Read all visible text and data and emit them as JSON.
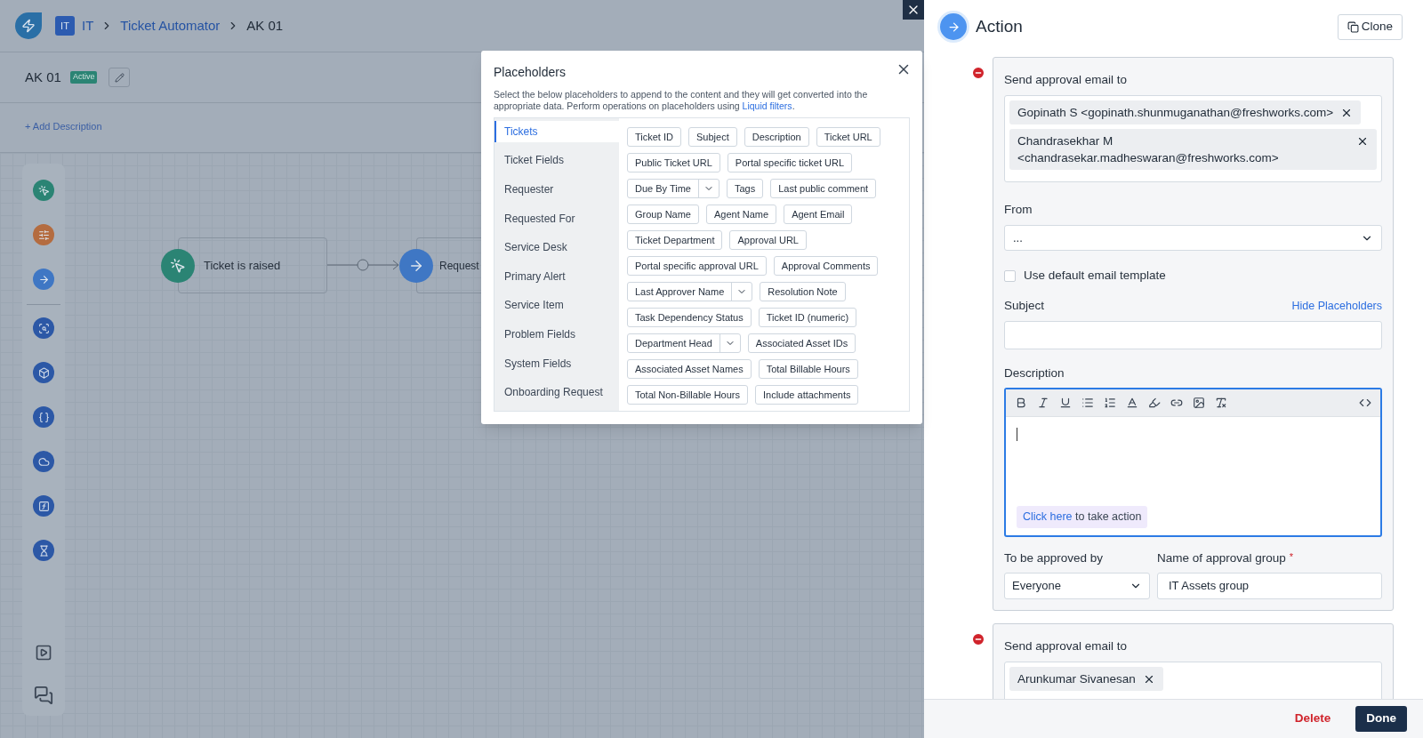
{
  "header": {
    "workspace_badge": "IT",
    "breadcrumb": [
      {
        "label": "IT",
        "kind": "link"
      },
      {
        "label": "Ticket Automator",
        "kind": "link"
      },
      {
        "label": "AK 01",
        "kind": "current"
      }
    ]
  },
  "workflow": {
    "name": "AK 01",
    "status": "Active",
    "add_description": "+ Add Description"
  },
  "canvas": {
    "nodes": [
      {
        "kind": "trigger",
        "label": "Ticket is raised"
      },
      {
        "kind": "action",
        "label": "Request"
      }
    ]
  },
  "placeholders_modal": {
    "title": "Placeholders",
    "description": "Select the below placeholders to append to the content and they will get converted into the appropriate data. Perform operations on placeholders using",
    "link": "Liquid filters",
    "description_end": ".",
    "categories": [
      {
        "label": "Tickets",
        "selected": true
      },
      {
        "label": "Ticket Fields",
        "selected": false
      },
      {
        "label": "Requester",
        "selected": false
      },
      {
        "label": "Requested For",
        "selected": false
      },
      {
        "label": "Service Desk",
        "selected": false
      },
      {
        "label": "Primary Alert",
        "selected": false
      },
      {
        "label": "Service Item",
        "selected": false
      },
      {
        "label": "Problem Fields",
        "selected": false
      },
      {
        "label": "System Fields",
        "selected": false
      },
      {
        "label": "Onboarding Request",
        "selected": false
      }
    ],
    "chip_rows": [
      [
        {
          "label": "Ticket ID",
          "kind": "plain"
        },
        {
          "label": "Subject",
          "kind": "plain"
        },
        {
          "label": "Description",
          "kind": "plain"
        },
        {
          "label": "Ticket URL",
          "kind": "plain"
        }
      ],
      [
        {
          "label": "Public Ticket URL",
          "kind": "plain"
        },
        {
          "label": "Portal specific ticket URL",
          "kind": "plain"
        }
      ],
      [
        {
          "label": "Due By Time",
          "kind": "split"
        },
        {
          "label": "Tags",
          "kind": "plain"
        },
        {
          "label": "Last public comment",
          "kind": "plain"
        }
      ],
      [
        {
          "label": "Group Name",
          "kind": "plain"
        },
        {
          "label": "Agent Name",
          "kind": "plain"
        },
        {
          "label": "Agent Email",
          "kind": "plain"
        }
      ],
      [
        {
          "label": "Ticket Department",
          "kind": "plain"
        },
        {
          "label": "Approval URL",
          "kind": "plain"
        }
      ],
      [
        {
          "label": "Portal specific approval URL",
          "kind": "plain"
        },
        {
          "label": "Approval Comments",
          "kind": "plain"
        }
      ],
      [
        {
          "label": "Last Approver Name",
          "kind": "split"
        },
        {
          "label": "Resolution Note",
          "kind": "plain"
        }
      ],
      [
        {
          "label": "Task Dependency Status",
          "kind": "plain"
        },
        {
          "label": "Ticket ID (numeric)",
          "kind": "plain"
        }
      ],
      [
        {
          "label": "Department Head",
          "kind": "split"
        },
        {
          "label": "Associated Asset IDs",
          "kind": "plain"
        }
      ],
      [
        {
          "label": "Associated Asset Names",
          "kind": "plain"
        },
        {
          "label": "Total Billable Hours",
          "kind": "plain"
        }
      ],
      [
        {
          "label": "Total Non-Billable Hours",
          "kind": "plain"
        },
        {
          "label": "Include attachments",
          "kind": "plain"
        }
      ]
    ]
  },
  "action_panel": {
    "title": "Action",
    "clone": "Clone",
    "blocks": [
      {
        "recipients_label": "Send approval email to",
        "recipients": [
          "Gopinath S <gopinath.shunmuganathan@freshworks.com>",
          "Chandrasekhar M <chandrasekar.madheswaran@freshworks.com>"
        ],
        "from_label": "From",
        "from_value": "...",
        "template": {
          "label": "Use default email template",
          "checked": false
        },
        "subject_label": "Subject",
        "hide_placeholders": "Hide Placeholders",
        "description_label": "Description",
        "editor_prompt_link": "Click here",
        "editor_prompt_text": "to take action",
        "approved_by_label": "To be approved by",
        "approved_by": "Everyone",
        "group_label": "Name of approval group",
        "required_mark": "*",
        "group_value": "IT Assets group"
      },
      {
        "recipients_label": "Send approval email to",
        "recipients": [
          "Arunkumar Sivanesan"
        ]
      }
    ],
    "footer": {
      "delete": "Delete",
      "done": "Done"
    }
  }
}
